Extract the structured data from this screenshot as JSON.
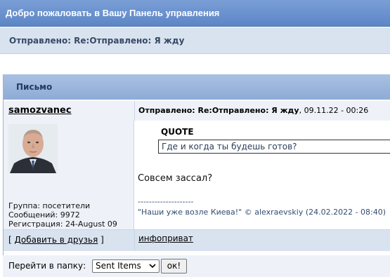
{
  "header": {
    "welcome": "Добро пожаловать в Вашу Панель управления"
  },
  "subject_bar": {
    "text": "Отправлено: Re:Отправлено: Я жду"
  },
  "box": {
    "title": "Письмо"
  },
  "post": {
    "author": "samozvanec",
    "subject_label": "Отправлено: Re:Отправлено: Я жду",
    "datetime": ", 09.11.22 - 00:26",
    "avatar_icon": "user-avatar-photo",
    "user_group": "Группа: посетители",
    "user_posts": "Сообщений: 9972",
    "user_registered": "Регистрация: 24-August 09",
    "quote_label": "QUOTE",
    "quote_text": "Где и когда ты будешь готов?",
    "message": "Совсем зассал?",
    "signature_separator": "--------------------",
    "signature": "\"Наши уже возле Киева!\" © alexraevskiy (24.02.2022 - 08:40)"
  },
  "actions": {
    "add_friend_open": "[ ",
    "add_friend_label": "Добавить в друзья",
    "add_friend_close": " ]",
    "info_private": "инфоприват"
  },
  "folder_nav": {
    "label": "Перейти в папку:",
    "selected": "Sent Items",
    "button": "ок!"
  },
  "colors": {
    "header_bg": "#6a92cf",
    "subject_bg": "#d9e3f0",
    "box_head_bg": "#9cb5dc",
    "row_bg": "#eef2f8",
    "signature_text": "#334b73"
  }
}
